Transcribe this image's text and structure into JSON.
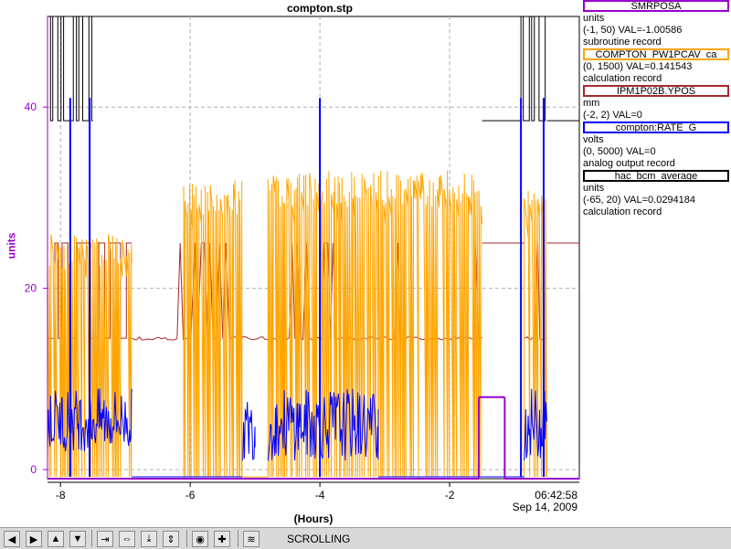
{
  "title": "compton.stp",
  "y_axis_label": "units",
  "x_axis_label": "(Hours)",
  "time_label": "06:42:58",
  "date_label": "Sep 14, 2009",
  "legend": [
    {
      "name": "SMRPOSA",
      "units": "units",
      "range_val": "(-1, 50) VAL=-1.00586",
      "type": "subroutine record",
      "color": "#9900cc"
    },
    {
      "name": "COMPTON_PW1PCAV_ca",
      "units": "",
      "range_val": "(0, 1500) VAL=0.141543",
      "type": "calculation record",
      "color": "#ffa500"
    },
    {
      "name": "IPM1P02B.YPOS",
      "units": "mm",
      "range_val": "(-2, 2) VAL=0",
      "type": "",
      "color": "#a52a2a"
    },
    {
      "name": "compton:RATE_G",
      "units": "volts",
      "range_val": "(0, 5000) VAL=0",
      "type": "analog output record",
      "color": "#0000ff"
    },
    {
      "name": "hac_bcm_average",
      "units": "units",
      "range_val": "(-65, 20) VAL=0.0294184",
      "type": "calculation record",
      "color": "#000000"
    }
  ],
  "toolbar": {
    "mode_label": "SCROLLING",
    "buttons": [
      {
        "name": "pan-left-button",
        "glyph": "◀"
      },
      {
        "name": "pan-right-button",
        "glyph": "▶"
      },
      {
        "name": "pan-up-button",
        "glyph": "▲"
      },
      {
        "name": "pan-down-button",
        "glyph": "▼"
      },
      {
        "name": "zoom-in-x-button",
        "glyph": "⇥"
      },
      {
        "name": "zoom-out-x-button",
        "glyph": "⇔"
      },
      {
        "name": "zoom-in-y-button",
        "glyph": "⤓"
      },
      {
        "name": "zoom-out-y-button",
        "glyph": "⇕"
      },
      {
        "name": "autoscale-button",
        "glyph": "◉"
      },
      {
        "name": "reset-button",
        "glyph": "✚"
      },
      {
        "name": "scroll-mode-button",
        "glyph": "≋"
      }
    ]
  },
  "chart_data": {
    "type": "line",
    "xlabel": "(Hours)",
    "ylabel": "units",
    "xlim": [
      -8.2,
      0
    ],
    "ylim": [
      -1,
      50
    ],
    "x_ticks": [
      -8,
      -6,
      -4,
      -2
    ],
    "y_ticks": [
      0,
      20,
      40
    ],
    "y_tick_labels": [
      "0",
      "20",
      "40"
    ],
    "x_tick_labels": [
      "-8",
      "-6",
      "-4",
      "-2"
    ],
    "grid": true,
    "series": [
      {
        "name": "hac_bcm_average",
        "color": "#000000",
        "segments": [
          {
            "x": [
              -8.2,
              -7.5,
              -4.0,
              -1.5
            ],
            "pattern": "toggle",
            "low": 38.5,
            "high": 50,
            "ends_at": -1.5
          },
          {
            "x": [
              -1.5,
              -0.9
            ],
            "y": [
              38.5,
              38.5
            ]
          },
          {
            "x": [
              -0.9,
              -0.5
            ],
            "pattern": "toggle",
            "low": 38.5,
            "high": 50
          },
          {
            "x": [
              -0.5,
              0
            ],
            "y": [
              38.5,
              38.5
            ]
          }
        ]
      },
      {
        "name": "IPM1P02B.YPOS",
        "color": "#a52a2a",
        "segments": [
          {
            "x": [
              -8.2,
              -6.9
            ],
            "pattern": "toggle",
            "low": 14.5,
            "high": 25
          },
          {
            "x": [
              -6.9,
              -1.5
            ],
            "baseline": 14.5,
            "pattern": "spiky",
            "high": 25
          },
          {
            "x": [
              -1.5,
              -0.85
            ],
            "y": [
              25,
              25
            ]
          },
          {
            "x": [
              -0.85,
              -0.5
            ],
            "baseline": 14.5,
            "pattern": "spiky",
            "high": 25
          },
          {
            "x": [
              -0.5,
              0
            ],
            "y": [
              25,
              25
            ]
          }
        ]
      },
      {
        "name": "COMPTON_PW1PCAV_ca",
        "color": "#ffa500",
        "segments": [
          {
            "x": [
              -8.2,
              -6.9
            ],
            "pattern": "burst",
            "low": -0.8,
            "high": 26
          },
          {
            "x": [
              -6.9,
              -6.1
            ],
            "y": [
              -0.8,
              -0.8
            ]
          },
          {
            "x": [
              -6.1,
              -5.2
            ],
            "pattern": "burst",
            "low": -0.8,
            "high": 32
          },
          {
            "x": [
              -5.2,
              -4.8
            ],
            "y": [
              -0.8,
              -0.8
            ]
          },
          {
            "x": [
              -4.8,
              -1.5
            ],
            "pattern": "burst",
            "low": -0.8,
            "high": 33
          },
          {
            "x": [
              -1.5,
              -0.85
            ],
            "y": [
              -0.8,
              -0.8
            ]
          },
          {
            "x": [
              -0.85,
              -0.5
            ],
            "pattern": "burst",
            "low": -0.8,
            "high": 31
          }
        ]
      },
      {
        "name": "compton:RATE_G",
        "color": "#0000ff",
        "segments": [
          {
            "x": [
              -8.2,
              -6.9
            ],
            "pattern": "noise",
            "low": 2,
            "high": 9
          },
          {
            "x": [
              -6.9,
              -5.2
            ],
            "y": [
              -0.8,
              -0.8
            ]
          },
          {
            "x": [
              -5.2,
              -5.0
            ],
            "pattern": "noise",
            "low": 1,
            "high": 8
          },
          {
            "x": [
              -4.8,
              -3.1
            ],
            "pattern": "noise",
            "low": 1,
            "high": 9
          },
          {
            "x": [
              -3.1,
              -0.85
            ],
            "y": [
              -0.8,
              -0.8
            ]
          },
          {
            "x": [
              -0.85,
              -0.5
            ],
            "pattern": "noise",
            "low": 1,
            "high": 9
          }
        ],
        "spikes": [
          -7.85,
          -7.55,
          -4.0,
          -0.9,
          -0.55
        ]
      },
      {
        "name": "SMRPOSA",
        "color": "#9900cc",
        "segments": [
          {
            "x": [
              -8.2,
              -1.55
            ],
            "y": [
              -1,
              -1
            ]
          },
          {
            "x": [
              -1.55,
              -1.55
            ],
            "y": [
              -1,
              8
            ]
          },
          {
            "x": [
              -1.55,
              -1.15
            ],
            "y": [
              8,
              8
            ]
          },
          {
            "x": [
              -1.15,
              -1.15
            ],
            "y": [
              8,
              -1
            ]
          },
          {
            "x": [
              -1.15,
              0
            ],
            "y": [
              -1,
              -1
            ]
          }
        ]
      }
    ]
  }
}
